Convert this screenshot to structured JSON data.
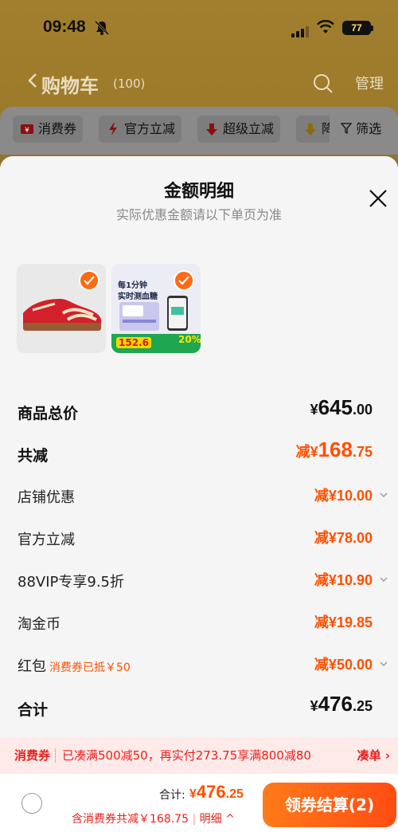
{
  "status_bar": {
    "time": "09:48",
    "battery": "77"
  },
  "cart_header": {
    "title": "购物车",
    "count": "(100)",
    "manage_label": "管理",
    "filters": [
      "消费券",
      "官方立减",
      "超级立减",
      "降"
    ],
    "filter_label": "筛选"
  },
  "sheet": {
    "title": "金额明细",
    "subtitle": "实际优惠金额请以下单页为准",
    "products": [
      {
        "icon": "red-sneaker-image"
      },
      {
        "icon": "glucose-monitor-image",
        "line1": "每1分钟",
        "line2": "实时测血糖",
        "price": "152.6",
        "percent": "20%"
      }
    ],
    "rows": [
      {
        "label": "商品总价",
        "currency": "¥",
        "value_int": "645",
        "value_dec": ".00",
        "prefix": "",
        "chevron": false
      },
      {
        "label": "共减",
        "currency": "¥",
        "value_int": "168",
        "value_dec": ".75",
        "prefix": "减",
        "chevron": false
      },
      {
        "label": "店铺优惠",
        "currency": "¥",
        "value_int": "10",
        "value_dec": ".00",
        "prefix": "减",
        "chevron": true
      },
      {
        "label": "官方立减",
        "currency": "¥",
        "value_int": "78",
        "value_dec": ".00",
        "prefix": "减",
        "chevron": false
      },
      {
        "label": "88VIP专享9.5折",
        "currency": "¥",
        "value_int": "10",
        "value_dec": ".90",
        "prefix": "减",
        "chevron": true
      },
      {
        "label": "淘金币",
        "currency": "¥",
        "value_int": "19",
        "value_dec": ".85",
        "prefix": "减",
        "chevron": false
      },
      {
        "label": "红包",
        "note": "消费券已抵￥50",
        "currency": "¥",
        "value_int": "50",
        "value_dec": ".00",
        "prefix": "减",
        "chevron": true
      },
      {
        "label": "合计",
        "currency": "¥",
        "value_int": "476",
        "value_dec": ".25",
        "prefix": "",
        "chevron": false
      }
    ]
  },
  "promo": {
    "tag": "消费券",
    "text": "已凑满500减50，再实付273.75享满800减80",
    "link": "凑单 ›"
  },
  "footer": {
    "total_label": "合计:",
    "total_currency": "¥",
    "total_int": "476",
    "total_dec": ".25",
    "discount_text": "含消费券共减￥168.75",
    "detail_link": "明细 ^",
    "checkout_label": "领券结算(2)"
  },
  "colors": {
    "accent": "#ff5000",
    "promo_red": "#e8211b",
    "checkout_start": "#ff7a1a",
    "checkout_end": "#ff4d12"
  }
}
